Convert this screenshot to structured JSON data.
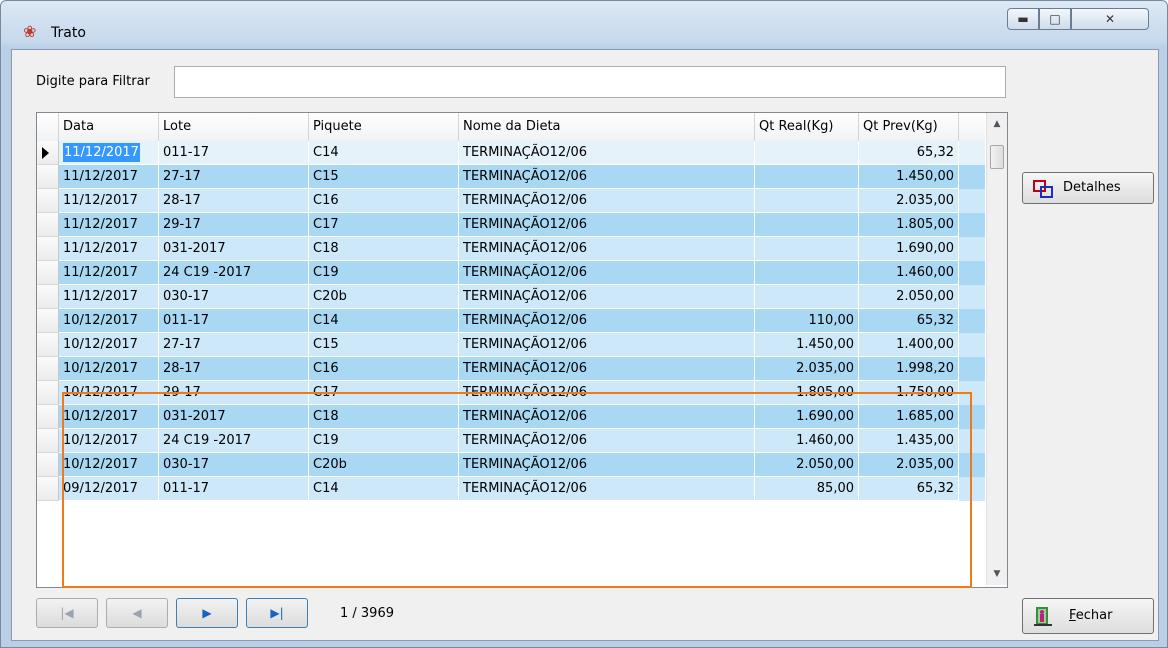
{
  "window": {
    "title": "Trato",
    "icon": "app-icon"
  },
  "filter": {
    "label": "Digite para Filtrar",
    "value": ""
  },
  "grid": {
    "columns": [
      "Data",
      "Lote",
      "Piquete",
      "Nome da Dieta",
      "Qt Real(Kg)",
      "Qt Prev(Kg)"
    ],
    "rows": [
      {
        "data": "11/12/2017",
        "lote": "011-17",
        "piquete": "C14",
        "dieta": "TERMINAÇÃO12/06",
        "real": "",
        "prev": "65,32"
      },
      {
        "data": "11/12/2017",
        "lote": "27-17",
        "piquete": "C15",
        "dieta": "TERMINAÇÃO12/06",
        "real": "",
        "prev": "1.450,00"
      },
      {
        "data": "11/12/2017",
        "lote": "28-17",
        "piquete": "C16",
        "dieta": "TERMINAÇÃO12/06",
        "real": "",
        "prev": "2.035,00"
      },
      {
        "data": "11/12/2017",
        "lote": "29-17",
        "piquete": "C17",
        "dieta": "TERMINAÇÃO12/06",
        "real": "",
        "prev": "1.805,00"
      },
      {
        "data": "11/12/2017",
        "lote": "031-2017",
        "piquete": "C18",
        "dieta": "TERMINAÇÃO12/06",
        "real": "",
        "prev": "1.690,00"
      },
      {
        "data": "11/12/2017",
        "lote": "24 C19 -2017",
        "piquete": "C19",
        "dieta": "TERMINAÇÃO12/06",
        "real": "",
        "prev": "1.460,00"
      },
      {
        "data": "11/12/2017",
        "lote": "030-17",
        "piquete": "C20b",
        "dieta": "TERMINAÇÃO12/06",
        "real": "",
        "prev": "2.050,00"
      },
      {
        "data": "10/12/2017",
        "lote": "011-17",
        "piquete": "C14",
        "dieta": "TERMINAÇÃO12/06",
        "real": "110,00",
        "prev": "65,32"
      },
      {
        "data": "10/12/2017",
        "lote": "27-17",
        "piquete": "C15",
        "dieta": "TERMINAÇÃO12/06",
        "real": "1.450,00",
        "prev": "1.400,00"
      },
      {
        "data": "10/12/2017",
        "lote": "28-17",
        "piquete": "C16",
        "dieta": "TERMINAÇÃO12/06",
        "real": "2.035,00",
        "prev": "1.998,20"
      },
      {
        "data": "10/12/2017",
        "lote": "29-17",
        "piquete": "C17",
        "dieta": "TERMINAÇÃO12/06",
        "real": "1.805,00",
        "prev": "1.750,00"
      },
      {
        "data": "10/12/2017",
        "lote": "031-2017",
        "piquete": "C18",
        "dieta": "TERMINAÇÃO12/06",
        "real": "1.690,00",
        "prev": "1.685,00"
      },
      {
        "data": "10/12/2017",
        "lote": "24 C19 -2017",
        "piquete": "C19",
        "dieta": "TERMINAÇÃO12/06",
        "real": "1.460,00",
        "prev": "1.435,00"
      },
      {
        "data": "10/12/2017",
        "lote": "030-17",
        "piquete": "C20b",
        "dieta": "TERMINAÇÃO12/06",
        "real": "2.050,00",
        "prev": "2.035,00"
      },
      {
        "data": "09/12/2017",
        "lote": "011-17",
        "piquete": "C14",
        "dieta": "TERMINAÇÃO12/06",
        "real": "85,00",
        "prev": "65,32"
      }
    ],
    "current_row": 0
  },
  "pager": {
    "position": "1 / 3969"
  },
  "buttons": {
    "detalhes": "Detalhes",
    "fechar": "Fechar"
  },
  "colors": {
    "highlight": "#f07a1a",
    "row_even": "#cce8f9",
    "row_odd": "#a9d8f4",
    "selection": "#3399ff"
  }
}
